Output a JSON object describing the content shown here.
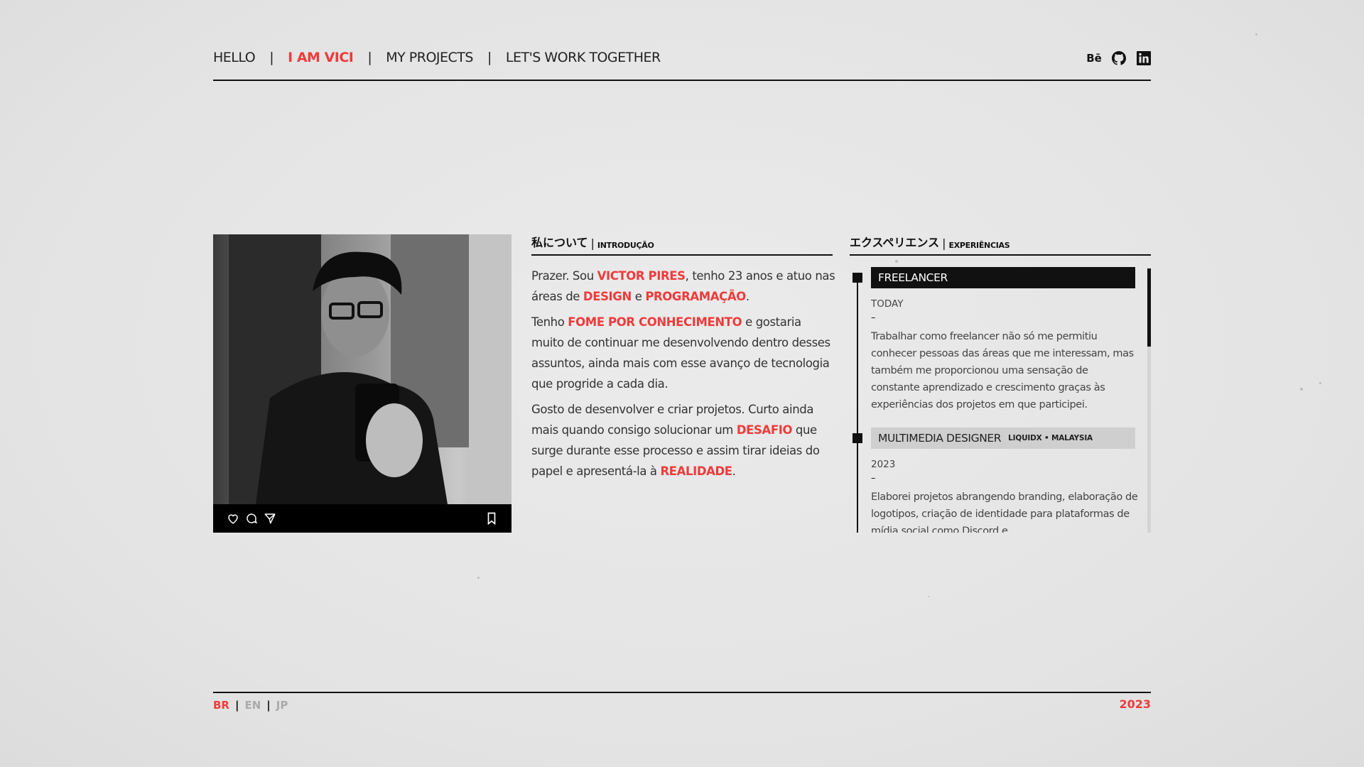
{
  "colors": {
    "accent": "#ee3b3b",
    "ink": "#111111",
    "background": "#e6e6e6"
  },
  "nav": {
    "links": [
      "HELLO",
      "I AM VICI",
      "MY PROJECTS",
      "LET'S WORK TOGETHER"
    ],
    "separator": "|",
    "active": "I AM VICI",
    "social": {
      "behance": "Bē",
      "github_icon": "github-icon",
      "linkedin_icon": "linkedin-icon"
    }
  },
  "photo_card": {
    "icons": [
      "heart-icon",
      "comment-icon",
      "send-icon",
      "bookmark-icon"
    ]
  },
  "about": {
    "heading_jp": "私について",
    "heading_bar": "|",
    "heading_sub": "INTRODUÇÃO",
    "p1": {
      "a": "Prazer. Sou ",
      "b": "VICTOR PIRES",
      "c": ", tenho 23 anos e atuo nas áreas de ",
      "d": "DESIGN",
      "e": " e ",
      "f": "PROGRAMAÇÃO",
      "g": "."
    },
    "p2": {
      "a": "Tenho ",
      "b": "FOME POR CONHECIMENTO",
      "c": " e gostaria muito de continuar me desenvolvendo dentro desses assuntos, ainda mais com esse avanço de tecnologia que progride a cada dia."
    },
    "p3": {
      "a": "Gosto de desenvolver e criar projetos. Curto ainda mais quando consigo solucionar um ",
      "b": "DESAFIO",
      "c": " que surge durante esse processo e assim tirar ideias do papel e apresentá-la à ",
      "d": "REALIDADE",
      "e": "."
    }
  },
  "experience": {
    "heading_jp": "エクスペリエンス",
    "heading_bar": "|",
    "heading_sub": "EXPERIÊNCIAS",
    "jobs": [
      {
        "title": "FREELANCER",
        "meta": "",
        "date": "TODAY",
        "dash": "–",
        "description": "Trabalhar como freelancer não só me permitiu conhecer pessoas das áreas que me interessam, mas também me proporcionou uma sensação de constante aprendizado e crescimento graças às experiências dos projetos em que participei."
      },
      {
        "title": "MULTIMEDIA DESIGNER",
        "meta": "LIQUIDX • MALAYSIA",
        "date": "2023",
        "dash": "–",
        "description": "Elaborei projetos abrangendo branding, elaboração de logotipos, criação de identidade para plataformas de mídia social como Discord e"
      }
    ]
  },
  "footer": {
    "languages": [
      "BR",
      "EN",
      "JP"
    ],
    "active_language": "BR",
    "separator": "|",
    "year": "2023"
  }
}
